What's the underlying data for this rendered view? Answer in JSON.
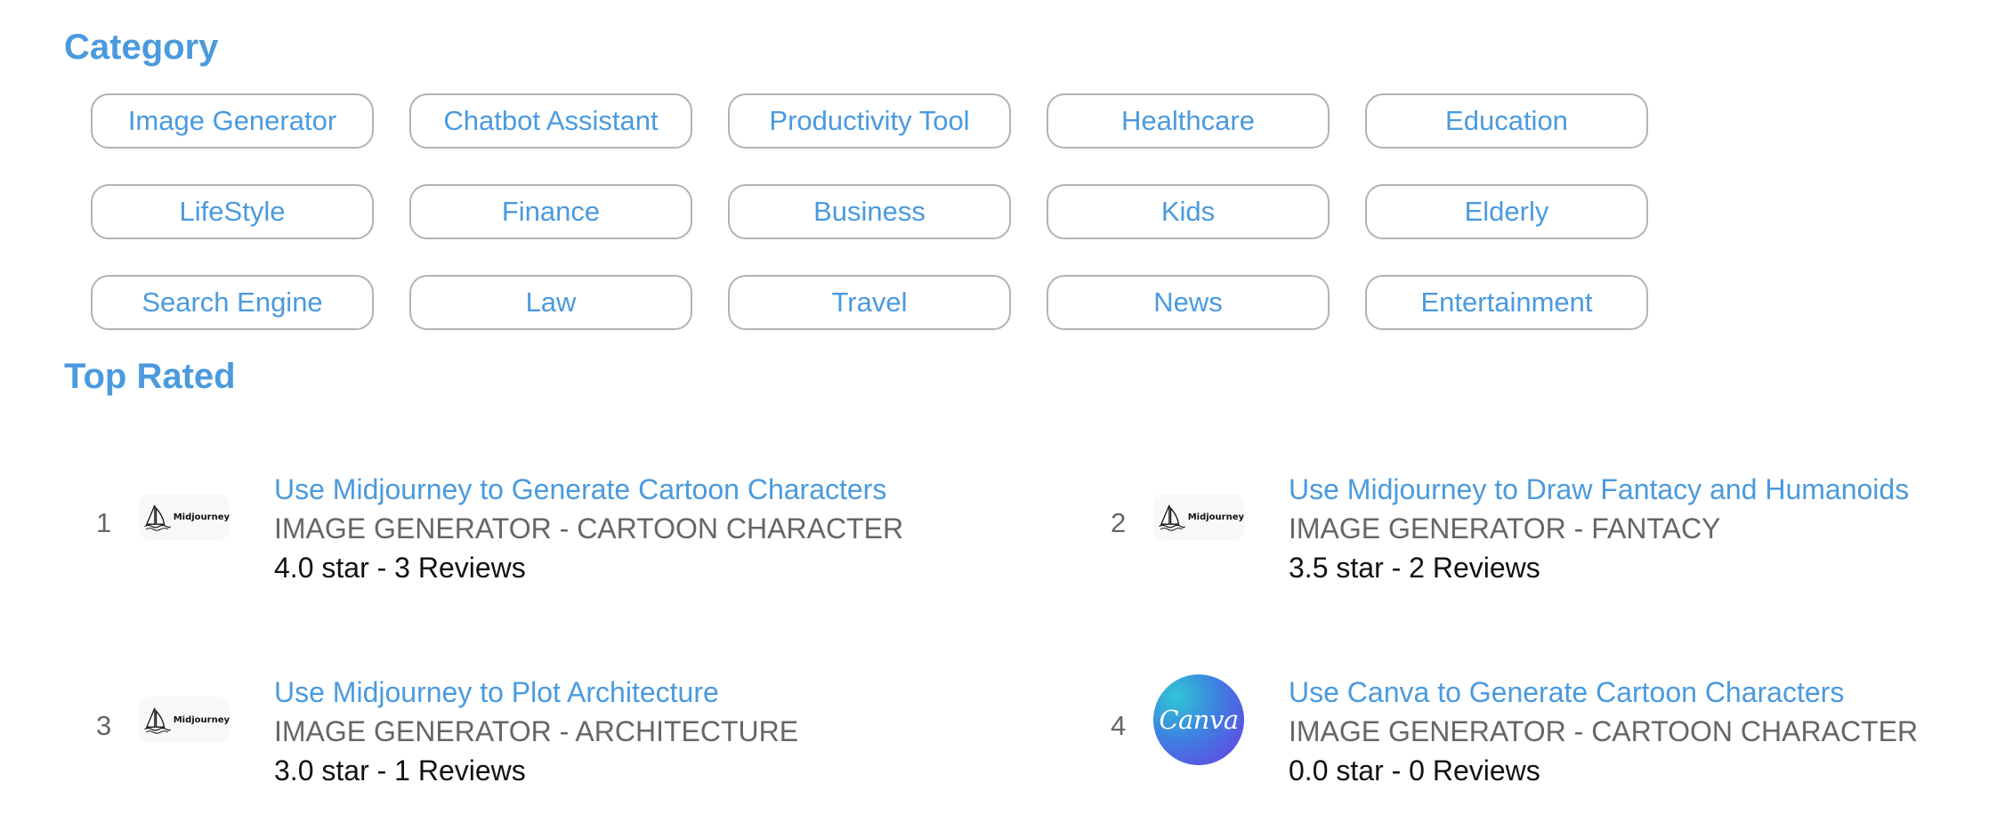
{
  "category": {
    "title": "Category",
    "items": [
      "Image Generator",
      "Chatbot Assistant",
      "Productivity Tool",
      "Healthcare",
      "Education",
      "LifeStyle",
      "Finance",
      "Business",
      "Kids",
      "Elderly",
      "Search Engine",
      "Law",
      "Travel",
      "News",
      "Entertainment"
    ]
  },
  "top_rated": {
    "title": "Top Rated",
    "items": [
      {
        "rank": "1",
        "logo": "midjourney-logo",
        "logo_text": "Midjourney",
        "title": "Use Midjourney to Generate Cartoon Characters",
        "category": "IMAGE GENERATOR - CARTOON CHARACTER",
        "rating": "4.0 star - 3 Reviews"
      },
      {
        "rank": "2",
        "logo": "midjourney-logo",
        "logo_text": "Midjourney",
        "title": "Use Midjourney to Draw Fantacy and Humanoids",
        "category": "IMAGE GENERATOR - FANTACY",
        "rating": "3.5 star - 2 Reviews"
      },
      {
        "rank": "3",
        "logo": "midjourney-logo",
        "logo_text": "Midjourney",
        "title": "Use Midjourney to Plot Architecture",
        "category": "IMAGE GENERATOR - ARCHITECTURE",
        "rating": "3.0 star - 1 Reviews"
      },
      {
        "rank": "4",
        "logo": "canva-logo",
        "logo_text": "Canva",
        "title": "Use Canva to Generate Cartoon Characters",
        "category": "IMAGE GENERATOR - CARTOON CHARACTER",
        "rating": "0.0 star - 0 Reviews"
      }
    ]
  },
  "colors": {
    "accent": "#4a9ade",
    "muted_text": "#666666",
    "pill_border": "#b3b3b3"
  }
}
